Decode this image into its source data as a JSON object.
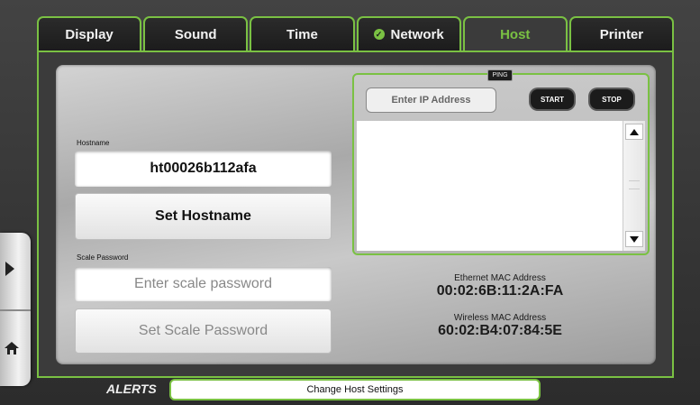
{
  "tabs": [
    {
      "label": "Display",
      "active": false,
      "checked": false
    },
    {
      "label": "Sound",
      "active": false,
      "checked": false
    },
    {
      "label": "Time",
      "active": false,
      "checked": false
    },
    {
      "label": "Network",
      "active": false,
      "checked": true
    },
    {
      "label": "Host",
      "active": true,
      "checked": false
    },
    {
      "label": "Printer",
      "active": false,
      "checked": false
    }
  ],
  "hostname": {
    "label": "Hostname",
    "value": "ht00026b112afa",
    "button": "Set Hostname"
  },
  "scale_password": {
    "label": "Scale Password",
    "placeholder": "Enter scale password",
    "button": "Set Scale Password"
  },
  "ping": {
    "tag": "PING",
    "ip_placeholder": "Enter IP Address",
    "start_label": "START",
    "stop_label": "STOP",
    "output": ""
  },
  "mac": {
    "ethernet_label": "Ethernet MAC Address",
    "ethernet_value": "00:02:6B:11:2A:FA",
    "wireless_label": "Wireless MAC Address",
    "wireless_value": "60:02:B4:07:84:5E"
  },
  "alerts": {
    "label": "ALERTS",
    "message": "Change Host Settings"
  },
  "colors": {
    "accent": "#7ac143",
    "tab_background": "#1c1c1c",
    "button_dark": "#1b1b1b"
  },
  "icons": {
    "side_expand": "chevron-right-icon",
    "home": "home-icon",
    "network_status": "check-circle-icon",
    "scroll_up": "arrow-up-icon",
    "scroll_down": "arrow-down-icon"
  }
}
